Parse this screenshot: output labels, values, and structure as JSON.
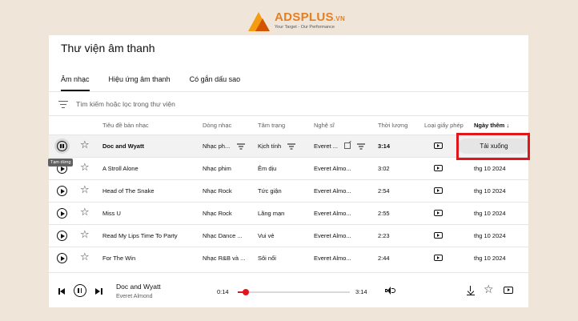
{
  "logo": {
    "brand": "ADSPLUS",
    "suffix": ".VN",
    "tagline": "Your Target - Our Performance"
  },
  "page": {
    "title": "Thư viện âm thanh"
  },
  "tabs": [
    {
      "label": "Âm nhạc",
      "active": true
    },
    {
      "label": "Hiệu ứng âm thanh",
      "active": false
    },
    {
      "label": "Có gắn dấu sao",
      "active": false
    }
  ],
  "search": {
    "placeholder": "Tìm kiếm hoặc lọc trong thư viện"
  },
  "columns": {
    "title": "Tiêu đề bản nhạc",
    "genre": "Dòng nhạc",
    "mood": "Tâm trạng",
    "artist": "Nghệ sĩ",
    "duration": "Thời lượng",
    "license": "Loại giấy phép",
    "date_added": "Ngày thêm"
  },
  "rows": [
    {
      "title": "Doc and Wyatt",
      "genre": "Nhạc ph...",
      "mood": "Kịch tính",
      "artist": "Everet ...",
      "duration": "3:14",
      "date": "",
      "action": "Tải xuống",
      "playing": true
    },
    {
      "title": "A Stroll Alone",
      "genre": "Nhạc phim",
      "mood": "Êm dịu",
      "artist": "Everet Almo...",
      "duration": "3:02",
      "date": "thg 10 2024"
    },
    {
      "title": "Head of The Snake",
      "genre": "Nhạc Rock",
      "mood": "Tức giận",
      "artist": "Everet Almo...",
      "duration": "2:54",
      "date": "thg 10 2024"
    },
    {
      "title": "Miss U",
      "genre": "Nhạc Rock",
      "mood": "Lãng mạn",
      "artist": "Everet Almo...",
      "duration": "2:55",
      "date": "thg 10 2024"
    },
    {
      "title": "Read My Lips Time To Party",
      "genre": "Nhạc Dance ...",
      "mood": "Vui vẻ",
      "artist": "Everet Almo...",
      "duration": "2:23",
      "date": "thg 10 2024"
    },
    {
      "title": "For The Win",
      "genre": "Nhạc R&B và ...",
      "mood": "Sôi nổi",
      "artist": "Everet Almo...",
      "duration": "2:44",
      "date": "thg 10 2024"
    }
  ],
  "tooltip": "Tạm dừng",
  "player": {
    "title": "Doc and Wyatt",
    "artist": "Everet Almond",
    "current": "0:14",
    "total": "3:14",
    "progress": 0.07
  },
  "colors": {
    "accent": "#e0161b",
    "highlight_box": "#e0161b"
  }
}
